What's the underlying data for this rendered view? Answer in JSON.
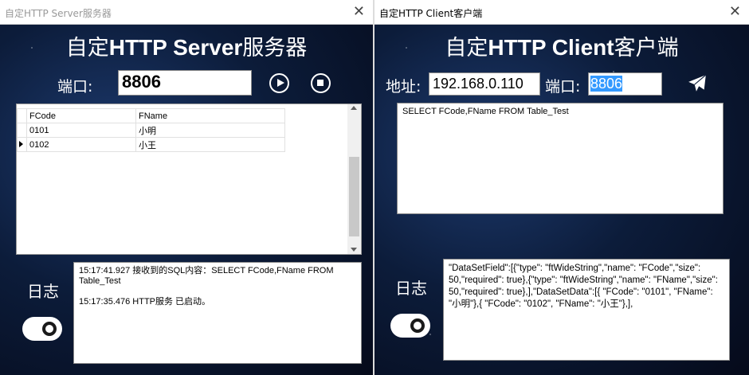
{
  "server": {
    "window_title": "自定HTTP Server服务器",
    "heading_prefix": "自定",
    "heading_bold": "HTTP Server",
    "heading_suffix": "服务器",
    "port_label": "端口:",
    "port_value": "8806",
    "grid": {
      "columns": [
        "FCode",
        "FName"
      ],
      "rows": [
        [
          "0101",
          "小明"
        ],
        [
          "0102",
          "小王"
        ]
      ]
    },
    "log_label": "日志",
    "log_lines": [
      "15:17:41.927 接收到的SQL内容：SELECT FCode,FName FROM Table_Test",
      "15:17:35.476 HTTP服务 已启动。"
    ]
  },
  "client": {
    "window_title": "自定HTTP Client客户端",
    "heading_prefix": "自定",
    "heading_bold": "HTTP Client",
    "heading_suffix": "客户端",
    "address_label": "地址:",
    "address_value": "192.168.0.110",
    "port_label": "端口:",
    "port_value": "8806",
    "sql_text": "SELECT FCode,FName FROM Table_Test",
    "log_label": "日志",
    "response_text": "\"DataSetField\":[{\"type\": \"ftWideString\",\"name\": \"FCode\",\"size\": 50,\"required\": true},{\"type\": \"ftWideString\",\"name\": \"FName\",\"size\": 50,\"required\": true},],\"DataSetData\":[{ \"FCode\": \"0101\", \"FName\": \"小明\"},{ \"FCode\": \"0102\", \"FName\": \"小王\"},],"
  },
  "icons": {
    "close": "close-icon",
    "play": "play-icon",
    "stop": "stop-icon",
    "send": "paper-plane-icon",
    "toggle": "toggle-switch",
    "row_indicator": "row-indicator-arrow"
  },
  "colors": {
    "background": "#0c1c3a",
    "selection": "#3399ff",
    "title_inactive": "#999999"
  }
}
